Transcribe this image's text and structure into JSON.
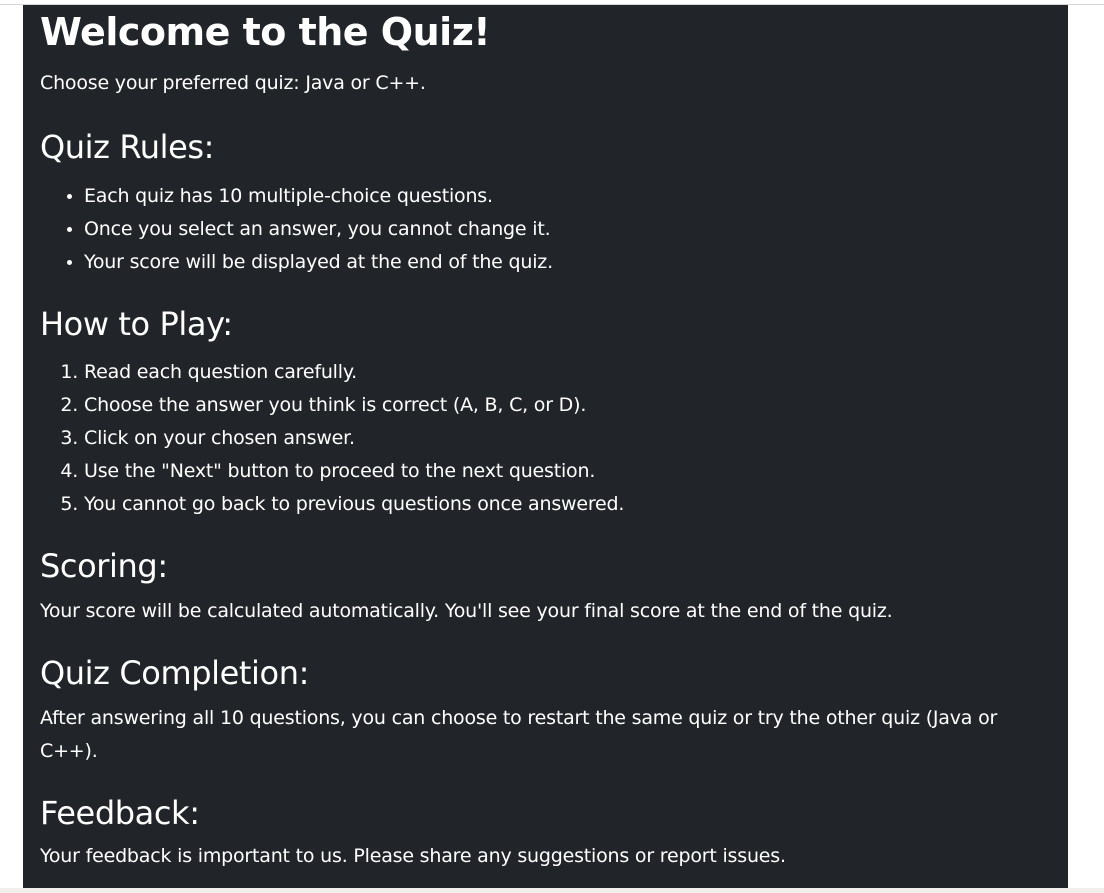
{
  "welcome": {
    "title": "Welcome to the Quiz!",
    "subtitle": "Choose your preferred quiz: Java or C++."
  },
  "rules": {
    "heading": "Quiz Rules:",
    "items": [
      "Each quiz has 10 multiple-choice questions.",
      "Once you select an answer, you cannot change it.",
      "Your score will be displayed at the end of the quiz."
    ]
  },
  "howto": {
    "heading": "How to Play:",
    "items": [
      "Read each question carefully.",
      "Choose the answer you think is correct (A, B, C, or D).",
      "Click on your chosen answer.",
      "Use the \"Next\" button to proceed to the next question.",
      "You cannot go back to previous questions once answered."
    ]
  },
  "scoring": {
    "heading": "Scoring:",
    "text": "Your score will be calculated automatically. You'll see your final score at the end of the quiz."
  },
  "completion": {
    "heading": "Quiz Completion:",
    "text": "After answering all 10 questions, you can choose to restart the same quiz or try the other quiz (Java or C++)."
  },
  "feedback": {
    "heading": "Feedback:",
    "text": "Your feedback is important to us. Please share any suggestions or report issues."
  },
  "colors": {
    "panel_bg": "#212529",
    "text": "#ffffff"
  }
}
